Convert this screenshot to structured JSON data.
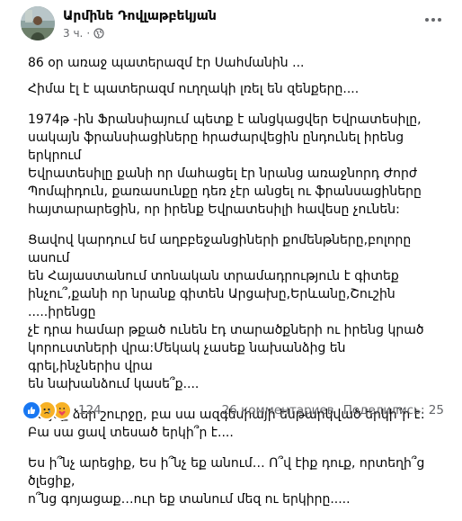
{
  "post": {
    "author": "Արմինե Դովլաթբեկյան",
    "time": "3 ч.",
    "dot": "·"
  },
  "body": {
    "paragraphs": [
      "86 օր առաջ պատերազմ էր Սահմանին ...",
      "Հիմա էլ է պատերազմ ուղղակի լռել են զենքերը....",
      "1974թ -ին  Ֆրանսիայում պետք է անցկացվեր Եվրատեսիլը,\nսակայն ֆրանսիացիները հրաժարվեցին ընդունել իրենց երկրում\nԵվրատեսիլը քանի որ մահացել էր նրանց առաջնորդ  Ժորժ\nՊոմպիդուն, քառասունքը դեռ չէր անցել ու ֆրանսացիները\nհայտարարեցին, որ իրենք Եվրատեսիլի հավեսը չունեն:",
      "Ցավով կարդում եմ  աղբբեջանցիների քոմենթները,բոլորը ասում\nեն  Հայաստանում տոնական տրամադրություն է գիտեք\nինչու՞,քանի որ նրանք գիտեն  Արցախը,Երևանը,Շուշին .....իրենցը\nչէ դրա համար թքած ունեն էդ տարածքների ու իրենց կրած\nկորուստների վրա:Մեկակ չասեք նախանձից են գրել,ինչներիս վրա\nեն նախանձում կասե՞ք....",
      "Նայեք ձեր շուրջը, բա սա ազգեսիայի ենթարկված երկի՞ր է:\n Բա սա ցավ տեսած երկի՞ր է....",
      " Ես ի՞նչ արեցիք, Ես ի՞նչ եք անում… Ո՞վ էիք դուք, որտեղի՞ց ծլեցիք,\nո՞նց գոյացաք…ուր եք տանում մեզ ու երկիրը....."
    ]
  },
  "footer": {
    "reaction_count": "124",
    "comments": "26 комментариев",
    "shares": "Поделились: 25"
  },
  "icons": {
    "globe": "globe-icon",
    "more": "more-options-icon",
    "like": "like-reaction-icon",
    "sad": "sad-reaction-icon",
    "care": "care-reaction-icon"
  },
  "colors": {
    "like": "#1877f2",
    "sad": "#f7b125",
    "care": "#f7b125",
    "secondary_text": "#65676b"
  }
}
